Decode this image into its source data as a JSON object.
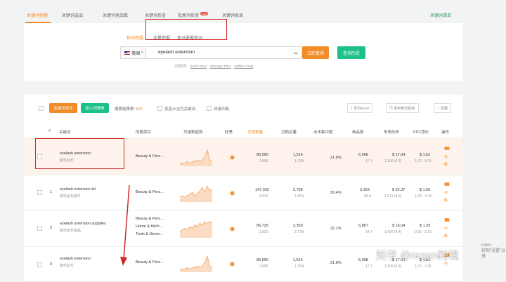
{
  "tabs": [
    {
      "label": "关键词挖掘",
      "active": true
    },
    {
      "label": "关键词选品",
      "active": false
    },
    {
      "label": "关键词竞品数",
      "active": false
    },
    {
      "label": "关键词反查",
      "active": false
    },
    {
      "label": "批量词反查",
      "active": false,
      "badge": "new"
    },
    {
      "label": "关键词收录",
      "active": false
    }
  ],
  "top_right_link": "关键词清单",
  "search": {
    "modes": [
      "拓词挖掘",
      "流量挖掘",
      "亚马逊推荐词"
    ],
    "country": "美国",
    "query": "eyelash extension",
    "search_button": "立即查询",
    "history_button": "查询历史",
    "example_prefix": "示例词:",
    "examples": [
      "lunch box",
      "storage bins",
      "coffee mug"
    ]
  },
  "toolbar": {
    "compare_button": "关键词对比",
    "add_button": "加入词清单",
    "result_label": "搜索结果数:",
    "result_count": "812",
    "filter1": "仅显示当月关键词",
    "filter2": "词组匹配",
    "export_label": "导出Excel",
    "copy_label": "复制到剪贴板",
    "hide_label": "隐藏"
  },
  "columns": [
    "#",
    "关键词",
    "所属类目",
    "月搜索趋势",
    "旺季",
    "月搜索量",
    "月购买量",
    "点击集中度",
    "商品数",
    "市场分析",
    "PPC竞价",
    "操作"
  ],
  "rows": [
    {
      "num": "",
      "keyword": "eyelash extension",
      "keyword_cn": "睫毛延长",
      "category": [
        "Beauty & Pers..."
      ],
      "search_volume": "86,560",
      "search_volume_sub": "2,885",
      "purchases": "1,514",
      "purchases_sub": "1.75%",
      "click_conc": "21.8%",
      "products": "5,068",
      "products_sub": "17.1",
      "market_price": "$ 17.04",
      "market_sub": "1,306 (4.3)",
      "ppc": "$ 1.62",
      "ppc_sub": "1.27 - 3.25"
    },
    {
      "num": "1",
      "keyword": "eyelash extension kit",
      "keyword_cn": "睫毛延长套件",
      "category": [
        "Beauty & Pers..."
      ],
      "search_volume": "147,933",
      "search_volume_sub": "4,931",
      "purchases": "2,736",
      "purchases_sub": "1.85%",
      "click_conc": "30.4%",
      "products": "3,163",
      "products_sub": "46.8",
      "market_price": "$ 22.37",
      "market_sub": "1,531 (4.0)",
      "ppc": "$ 1.66",
      "ppc_sub": "1.28 - 3.34"
    },
    {
      "num": "2",
      "keyword": "eyelash extension supplies",
      "keyword_cn": "睫毛延长用品",
      "category": [
        "Beauty & Pers...",
        "Home & Kitch...",
        "Tools & Home..."
      ],
      "search_volume": "86,725",
      "search_volume_sub": "2,891",
      "purchases": "2,350",
      "purchases_sub": "2.71%",
      "click_conc": "22.1%",
      "products": "5,887",
      "products_sub": "14.7",
      "market_price": "$ 16.04",
      "market_sub": "1,426 (4.4)",
      "ppc": "$ 1.29",
      "ppc_sub": "0.93 - 2.10"
    },
    {
      "num": "3",
      "keyword": "eyelash extension",
      "keyword_cn": "睫毛延长",
      "category": [
        "Beauty & Pers..."
      ],
      "search_volume": "86,560",
      "search_volume_sub": "2,885",
      "purchases": "1,514",
      "purchases_sub": "1.75%",
      "click_conc": "21.8%",
      "products": "5,068",
      "products_sub": "17.1",
      "market_price": "$ 17.04",
      "market_sub": "1,306 (4.3)",
      "ppc": "$ 1.62",
      "ppc_sub": "1.27 - 3.25"
    }
  ],
  "trend_series": [
    [
      1,
      1,
      1,
      2,
      1,
      2,
      2,
      3,
      2,
      3,
      5,
      9,
      3,
      2
    ],
    [
      2,
      3,
      2,
      3,
      4,
      5,
      3,
      4,
      6,
      8,
      5,
      9,
      6,
      7
    ],
    [
      3,
      4,
      5,
      4,
      6,
      5,
      7,
      6,
      8,
      7,
      9,
      8,
      9,
      8
    ],
    [
      1,
      1,
      1,
      2,
      1,
      2,
      2,
      3,
      2,
      3,
      5,
      9,
      3,
      2
    ]
  ],
  "watermark": "知乎 @regan跨境",
  "side_text": [
    "indov",
    "转到\"设置\"以激"
  ]
}
